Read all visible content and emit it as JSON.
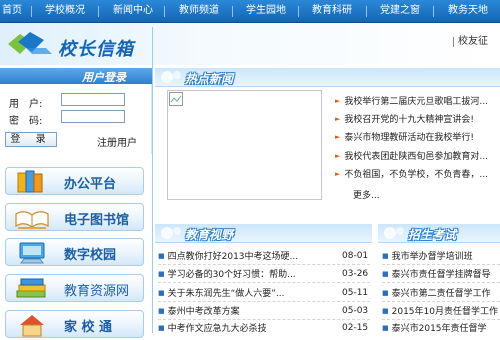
{
  "nav": {
    "items": [
      "首页",
      "学校概况",
      "新闻中心",
      "教师频道",
      "学生园地",
      "教育科研",
      "党建之窗",
      "教务天地"
    ]
  },
  "header": {
    "box_title": "校长信箱",
    "right_text": "校友征"
  },
  "login": {
    "heading": "用户登录",
    "username_label": "用　户:",
    "password_label": "密　码:",
    "username_value": "",
    "password_value": "",
    "login_button": "登 录",
    "register_link": "注册用户"
  },
  "side_buttons": [
    "办公平台",
    "电子图书馆",
    "数字校园",
    "教育资源网",
    "家 校 通"
  ],
  "hot_news": {
    "heading": "热点新闻",
    "items": [
      "我校举行第二届庆元旦歌唱工拔河...",
      "我校召开党的十九大精神宣讲会!",
      "泰兴市物理教研活动在我校举行!",
      "我校代表团赴陕西旬邑参加教育对...",
      "不负祖国，不负学校，不负青春，...",
      ""
    ],
    "more_label": "更多..."
  },
  "edu_vision": {
    "heading": "教育视野",
    "items": [
      {
        "title": "四点教你打好2013中考这场硬...",
        "date": "08-01"
      },
      {
        "title": "学习必备的30个好习惯：帮助...",
        "date": "03-26"
      },
      {
        "title": "关于朱东润先生“做人六要”...",
        "date": "05-11"
      },
      {
        "title": "泰州中考改革方案",
        "date": "05-03"
      },
      {
        "title": "中考作文应急九大必杀技",
        "date": "02-15"
      }
    ]
  },
  "enrollment": {
    "heading": "招生考试",
    "items": [
      "我市举办督学培训班",
      "泰兴市责任督学挂牌督导",
      "泰兴市第二责任督学工作",
      "2015年10月责任督学工作",
      "泰兴市2015年责任督学"
    ]
  },
  "colors": {
    "nav_bg": "#1a72c2",
    "accent_blue": "#1565b5",
    "bullet_orange": "#e05a10"
  }
}
